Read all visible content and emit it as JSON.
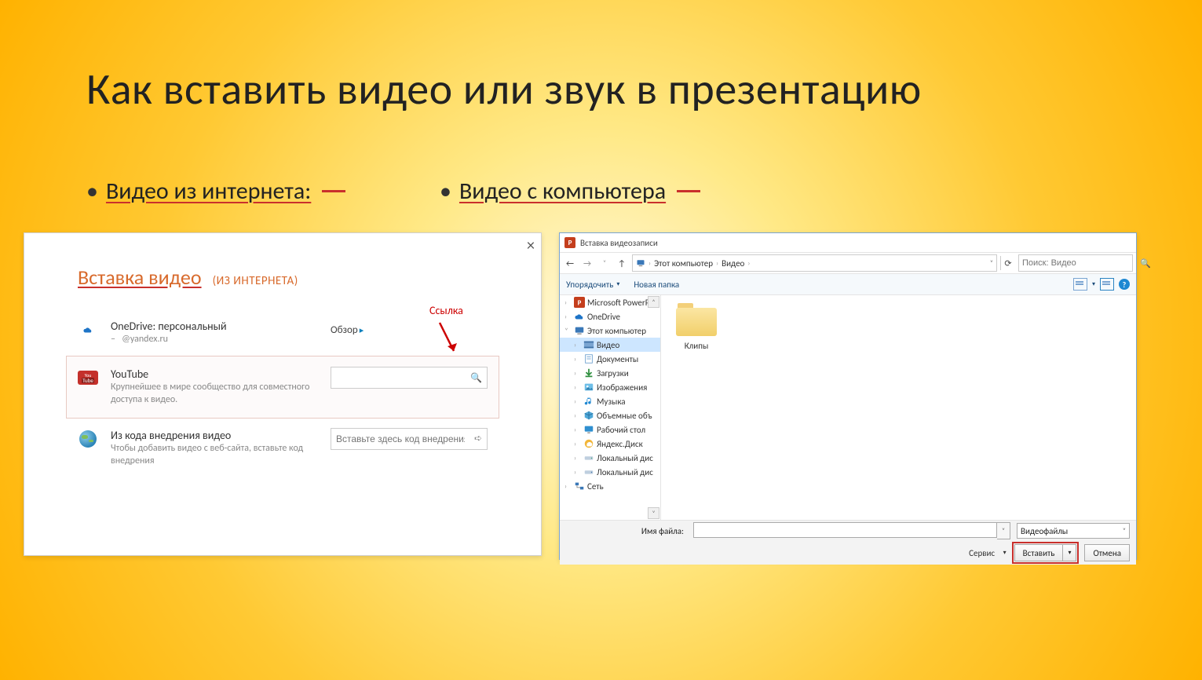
{
  "slide": {
    "title": "Как вставить видео или звук в презентацию",
    "bullet1": "Видео из интернета:",
    "bullet2": "Видео  с компьютера"
  },
  "left": {
    "dialog_title": "Вставка видео",
    "dialog_title_sub": "(ИЗ ИНТЕРНЕТА)",
    "annotation": "Ссылка",
    "rows": {
      "onedrive": {
        "title": "OneDrive: персональный",
        "sub": "@yandex.ru",
        "action": "Обзор"
      },
      "youtube": {
        "title": "YouTube",
        "sub": "Крупнейшее в мире сообщество для совместного доступа к видео.",
        "placeholder": ""
      },
      "embed": {
        "title": "Из кода внедрения видео",
        "sub": "Чтобы добавить видео с веб-сайта, вставьте код внедрения",
        "placeholder": "Вставьте здесь код внедрения"
      }
    }
  },
  "right": {
    "window_title": "Вставка видеозаписи",
    "breadcrumb": {
      "root": "Этот компьютер",
      "folder": "Видео"
    },
    "search_placeholder": "Поиск: Видео",
    "toolbar": {
      "organize": "Упорядочить",
      "newfolder": "Новая папка"
    },
    "tree": [
      {
        "label": "Microsoft PowerP",
        "exp": ">",
        "icon": "ppt",
        "lvl": 1
      },
      {
        "label": "OneDrive",
        "exp": ">",
        "icon": "onedrive",
        "lvl": 1
      },
      {
        "label": "Этот компьютер",
        "exp": "v",
        "icon": "pc",
        "lvl": 1
      },
      {
        "label": "Видео",
        "exp": ">",
        "icon": "video",
        "lvl": 2,
        "selected": true
      },
      {
        "label": "Документы",
        "exp": ">",
        "icon": "docs",
        "lvl": 2
      },
      {
        "label": "Загрузки",
        "exp": ">",
        "icon": "down",
        "lvl": 2
      },
      {
        "label": "Изображения",
        "exp": ">",
        "icon": "pics",
        "lvl": 2
      },
      {
        "label": "Музыка",
        "exp": ">",
        "icon": "music",
        "lvl": 2
      },
      {
        "label": "Объемные объ",
        "exp": ">",
        "icon": "cube",
        "lvl": 2
      },
      {
        "label": "Рабочий стол",
        "exp": ">",
        "icon": "desk",
        "lvl": 2
      },
      {
        "label": "Яндекс.Диск",
        "exp": ">",
        "icon": "ydisk",
        "lvl": 2
      },
      {
        "label": "Локальный дис",
        "exp": ">",
        "icon": "drive",
        "lvl": 2
      },
      {
        "label": "Локальный дис",
        "exp": ">",
        "icon": "drive2",
        "lvl": 2
      },
      {
        "label": "Сеть",
        "exp": ">",
        "icon": "net",
        "lvl": 1
      }
    ],
    "content_folder": "Клипы",
    "file_row": {
      "label": "Имя файла:",
      "type_filter": "Видеофайлы"
    },
    "buttons": {
      "service": "Сервис",
      "insert": "Вставить",
      "cancel": "Отмена"
    }
  }
}
